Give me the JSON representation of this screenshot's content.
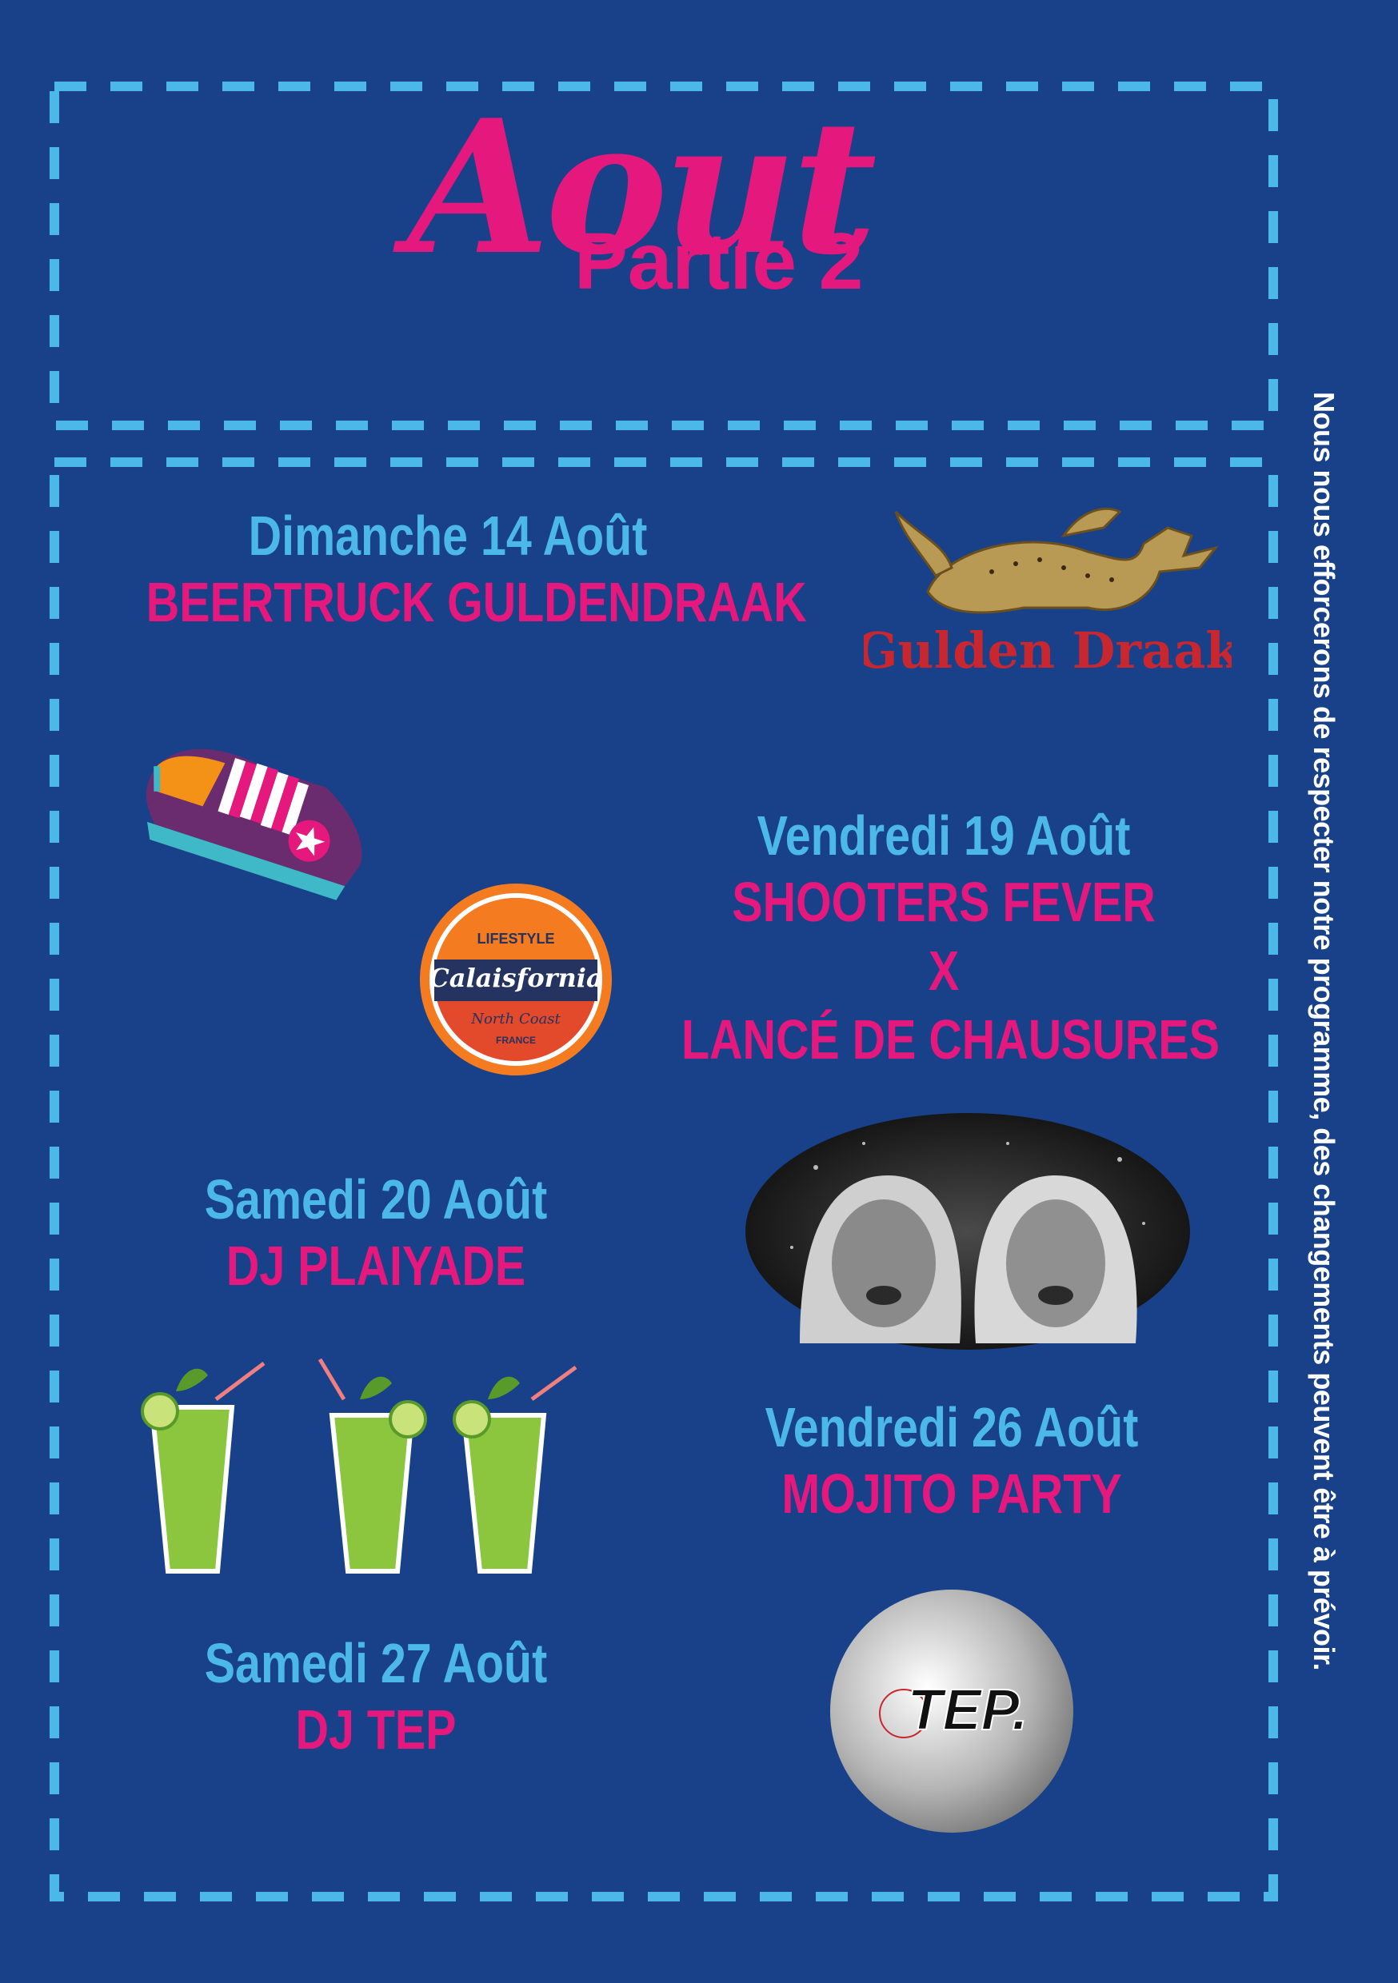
{
  "title": {
    "main": "Aout",
    "sub": "Partie 2"
  },
  "events": [
    {
      "date": "Dimanche 14 Août",
      "name": "BEERTRUCK GULDENDRAAK"
    },
    {
      "date": "Vendredi 19 Août",
      "name": "SHOOTERS FEVER",
      "name2": "X",
      "name3": "LANCÉ DE CHAUSURES"
    },
    {
      "date": "Samedi 20 Août",
      "name": "DJ PLAIYADE"
    },
    {
      "date": "Vendredi 26 Août",
      "name": "MOJITO PARTY"
    },
    {
      "date": "Samedi 27 Août",
      "name": "DJ TEP"
    }
  ],
  "logos": {
    "gulden": "Gulden Draak",
    "calais_top": "LIFESTYLE",
    "calais_main": "Calaisfornia",
    "calais_sub": "North Coast",
    "calais_country": "FRANCE",
    "tep": "TEP."
  },
  "side_note": "Nous nous efforcerons de respecter notre programme, des changements peuvent être à prévoir.",
  "colors": {
    "background": "#18418a",
    "pink": "#e5197d",
    "cyan": "#4cb8e8"
  }
}
